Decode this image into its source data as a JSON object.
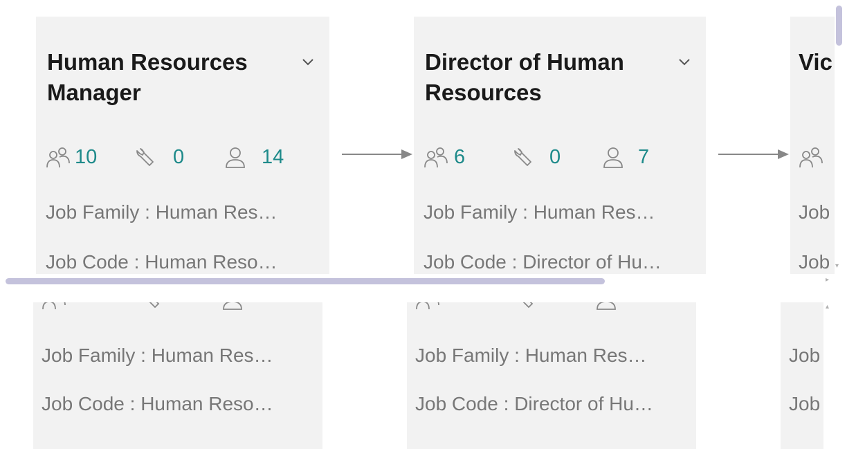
{
  "cards": [
    {
      "title": "Human Resources Manager",
      "stats": {
        "positions": "10",
        "tools": "0",
        "people": "14"
      },
      "job_family": "Job Family : Human Res…",
      "job_code": "Job Code : Human Reso…"
    },
    {
      "title": "Director of Human Resources",
      "stats": {
        "positions": "6",
        "tools": "0",
        "people": "7"
      },
      "job_family": "Job Family : Human Res…",
      "job_code": "Job Code : Director of Hu…"
    },
    {
      "title": "Vic",
      "job_family": "Job",
      "job_code": "Job"
    }
  ],
  "icons": {
    "positions": "users-group-icon",
    "tools": "wrench-icon",
    "people": "user-icon",
    "expand": "chevron-down-icon",
    "connector": "arrow-right-icon"
  },
  "colors": {
    "card_bg": "#f2f2f2",
    "stat_value": "#1e8a8a",
    "muted_text": "#777777",
    "scrollbar": "#c4c2dc"
  }
}
